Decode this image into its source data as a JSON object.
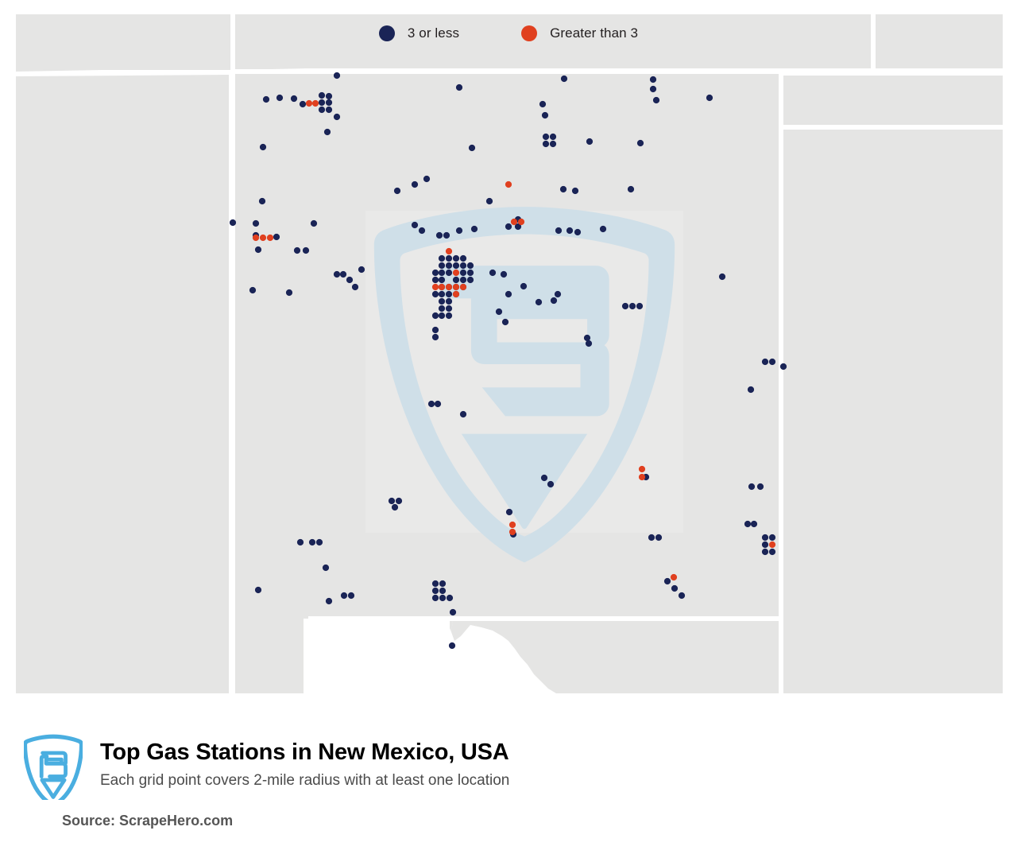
{
  "legend": {
    "items": [
      {
        "label": "3 or less",
        "color": "#1a2456",
        "icon": "circle-marker-icon"
      },
      {
        "label": "Greater than 3",
        "color": "#e0401f",
        "icon": "circle-marker-icon"
      }
    ]
  },
  "footer": {
    "logo_alt": "scrapehero-shield-logo",
    "title": "Top Gas Stations in New Mexico, USA",
    "subtitle": "Each grid point covers 2-mile radius with at least one location",
    "source": "Source: ScrapeHero.com"
  },
  "map": {
    "region": "New Mexico, USA",
    "land_color": "#e5e5e4",
    "border_color": "#ffffff",
    "page_color": "#ffffff",
    "watermark_color": "#cfdfe8",
    "watermark_panel_color": "#e9e9e8",
    "watermark_alt": "scrapehero-shield-watermark"
  },
  "chart_data": {
    "type": "scatter",
    "title": "Top Gas Stations in New Mexico, USA",
    "subtitle": "Each grid point covers 2-mile radius with at least one location",
    "xlabel": "",
    "ylabel": "",
    "grid": false,
    "legend_position": "top-center",
    "xlim": [
      0,
      1280
    ],
    "ylim": [
      900,
      0
    ],
    "note": "Pixel coordinates of grid markers over a New Mexico state map. 'low' = counts of 3 or less (navy), 'high' = counts greater than 3 (orange-red).",
    "series": [
      {
        "name": "3 or less",
        "color": "#1a2456",
        "count": 176,
        "points": [
          [
            335,
            125
          ],
          [
            352,
            123
          ],
          [
            370,
            124
          ],
          [
            381,
            131
          ],
          [
            405,
            120
          ],
          [
            414,
            121
          ],
          [
            405,
            129
          ],
          [
            414,
            129
          ],
          [
            405,
            138
          ],
          [
            414,
            138
          ],
          [
            424,
            95
          ],
          [
            424,
            147
          ],
          [
            412,
            166
          ],
          [
            331,
            185
          ],
          [
            330,
            253
          ],
          [
            293,
            280
          ],
          [
            322,
            281
          ],
          [
            395,
            281
          ],
          [
            322,
            296
          ],
          [
            348,
            298
          ],
          [
            325,
            314
          ],
          [
            374,
            315
          ],
          [
            385,
            315
          ],
          [
            318,
            365
          ],
          [
            364,
            368
          ],
          [
            424,
            345
          ],
          [
            432,
            345
          ],
          [
            440,
            352
          ],
          [
            447,
            361
          ],
          [
            500,
            240
          ],
          [
            522,
            232
          ],
          [
            537,
            225
          ],
          [
            578,
            110
          ],
          [
            594,
            186
          ],
          [
            616,
            253
          ],
          [
            640,
            285
          ],
          [
            652,
            285
          ],
          [
            652,
            276
          ],
          [
            683,
            131
          ],
          [
            686,
            145
          ],
          [
            687,
            172
          ],
          [
            696,
            172
          ],
          [
            687,
            181
          ],
          [
            696,
            181
          ],
          [
            710,
            99
          ],
          [
            709,
            238
          ],
          [
            724,
            240
          ],
          [
            742,
            178
          ],
          [
            759,
            288
          ],
          [
            794,
            238
          ],
          [
            806,
            180
          ],
          [
            822,
            100
          ],
          [
            822,
            112
          ],
          [
            826,
            126
          ],
          [
            893,
            123
          ],
          [
            909,
            348
          ],
          [
            787,
            385
          ],
          [
            796,
            385
          ],
          [
            805,
            385
          ],
          [
            553,
            296
          ],
          [
            562,
            296
          ],
          [
            578,
            290
          ],
          [
            597,
            288
          ],
          [
            556,
            325
          ],
          [
            565,
            325
          ],
          [
            574,
            325
          ],
          [
            583,
            325
          ],
          [
            556,
            334
          ],
          [
            565,
            334
          ],
          [
            574,
            334
          ],
          [
            583,
            334
          ],
          [
            592,
            334
          ],
          [
            548,
            343
          ],
          [
            556,
            343
          ],
          [
            565,
            343
          ],
          [
            583,
            343
          ],
          [
            592,
            343
          ],
          [
            548,
            352
          ],
          [
            556,
            352
          ],
          [
            574,
            352
          ],
          [
            583,
            352
          ],
          [
            592,
            352
          ],
          [
            556,
            361
          ],
          [
            565,
            361
          ],
          [
            574,
            361
          ],
          [
            583,
            361
          ],
          [
            548,
            370
          ],
          [
            556,
            370
          ],
          [
            565,
            370
          ],
          [
            574,
            370
          ],
          [
            556,
            379
          ],
          [
            565,
            379
          ],
          [
            556,
            388
          ],
          [
            565,
            388
          ],
          [
            548,
            397
          ],
          [
            556,
            397
          ],
          [
            565,
            397
          ],
          [
            548,
            415
          ],
          [
            548,
            424
          ],
          [
            620,
            343
          ],
          [
            634,
            345
          ],
          [
            640,
            370
          ],
          [
            659,
            360
          ],
          [
            678,
            380
          ],
          [
            636,
            405
          ],
          [
            697,
            378
          ],
          [
            702,
            370
          ],
          [
            741,
            432
          ],
          [
            739,
            425
          ],
          [
            543,
            508
          ],
          [
            551,
            508
          ],
          [
            583,
            521
          ],
          [
            945,
            490
          ],
          [
            963,
            455
          ],
          [
            972,
            455
          ],
          [
            986,
            461
          ],
          [
            946,
            612
          ],
          [
            957,
            612
          ],
          [
            941,
            659
          ],
          [
            949,
            659
          ],
          [
            963,
            676
          ],
          [
            972,
            676
          ],
          [
            963,
            685
          ],
          [
            963,
            694
          ],
          [
            972,
            694
          ],
          [
            820,
            676
          ],
          [
            829,
            676
          ],
          [
            813,
            600
          ],
          [
            685,
            601
          ],
          [
            693,
            609
          ],
          [
            641,
            644
          ],
          [
            646,
            672
          ],
          [
            493,
            630
          ],
          [
            502,
            630
          ],
          [
            497,
            638
          ],
          [
            378,
            682
          ],
          [
            393,
            682
          ],
          [
            402,
            682
          ],
          [
            410,
            714
          ],
          [
            325,
            742
          ],
          [
            414,
            756
          ],
          [
            433,
            749
          ],
          [
            442,
            749
          ],
          [
            548,
            734
          ],
          [
            557,
            734
          ],
          [
            548,
            743
          ],
          [
            557,
            743
          ],
          [
            548,
            752
          ],
          [
            557,
            752
          ],
          [
            566,
            752
          ],
          [
            570,
            770
          ],
          [
            569,
            812
          ],
          [
            840,
            731
          ],
          [
            849,
            740
          ],
          [
            858,
            749
          ],
          [
            628,
            392
          ],
          [
            703,
            290
          ],
          [
            717,
            290
          ],
          [
            727,
            292
          ],
          [
            522,
            283
          ],
          [
            531,
            290
          ],
          [
            455,
            339
          ]
        ]
      },
      {
        "name": "Greater than 3",
        "color": "#e0401f",
        "count": 22,
        "points": [
          [
            389,
            130
          ],
          [
            397,
            130
          ],
          [
            322,
            299
          ],
          [
            331,
            299
          ],
          [
            340,
            299
          ],
          [
            640,
            232
          ],
          [
            647,
            279
          ],
          [
            656,
            279
          ],
          [
            565,
            316
          ],
          [
            574,
            343
          ],
          [
            548,
            361
          ],
          [
            556,
            361
          ],
          [
            565,
            361
          ],
          [
            574,
            361
          ],
          [
            583,
            361
          ],
          [
            574,
            370
          ],
          [
            808,
            590
          ],
          [
            808,
            600
          ],
          [
            972,
            685
          ],
          [
            848,
            726
          ],
          [
            645,
            660
          ],
          [
            645,
            669
          ]
        ]
      }
    ]
  }
}
